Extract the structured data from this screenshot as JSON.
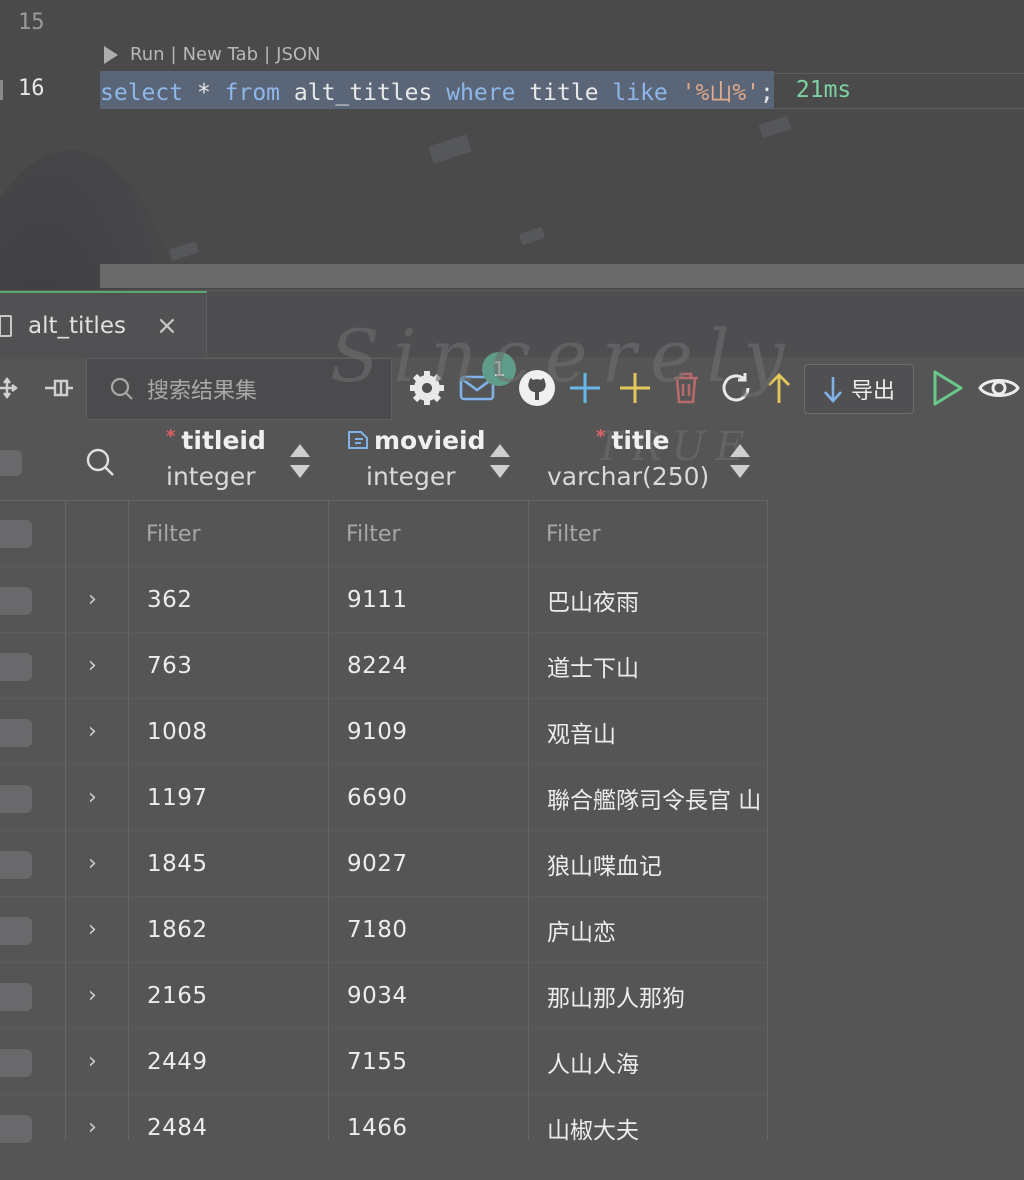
{
  "editor": {
    "prev_line_number": "15",
    "line_number": "16",
    "codelens": {
      "run": "Run",
      "sep1": "|",
      "new_tab": "New Tab",
      "sep2": "|",
      "json": "JSON"
    },
    "code": {
      "t1": "select",
      "t2": " * ",
      "t3": "from",
      "t4": " alt_titles ",
      "t5": "where",
      "t6": " title ",
      "t7": "like",
      "t8": " ",
      "t9": "'%山%'",
      "t10": ";"
    },
    "timing": "21ms"
  },
  "tab": {
    "label": "alt_titles",
    "close": "×"
  },
  "toolbar": {
    "search_placeholder": "搜索结果集",
    "mail_badge": "1",
    "export_label": "导出"
  },
  "watermark": {
    "line1": "Sincerely",
    "line2": "TRUE"
  },
  "columns": [
    {
      "name": "titleid",
      "type": "integer",
      "required": "*"
    },
    {
      "name": "movieid",
      "type": "integer"
    },
    {
      "name": "title",
      "type": "varchar(250)",
      "required": "*"
    }
  ],
  "filter_placeholder": "Filter",
  "rows": [
    {
      "titleid": "362",
      "movieid": "9111",
      "title": "巴山夜雨"
    },
    {
      "titleid": "763",
      "movieid": "8224",
      "title": "道士下山"
    },
    {
      "titleid": "1008",
      "movieid": "9109",
      "title": "观音山"
    },
    {
      "titleid": "1197",
      "movieid": "6690",
      "title": "聯合艦隊司令長官 山"
    },
    {
      "titleid": "1845",
      "movieid": "9027",
      "title": "狼山喋血记"
    },
    {
      "titleid": "1862",
      "movieid": "7180",
      "title": "庐山恋"
    },
    {
      "titleid": "2165",
      "movieid": "9034",
      "title": "那山那人那狗"
    },
    {
      "titleid": "2449",
      "movieid": "7155",
      "title": "人山人海"
    },
    {
      "titleid": "2484",
      "movieid": "1466",
      "title": "山椒大夫"
    }
  ]
}
